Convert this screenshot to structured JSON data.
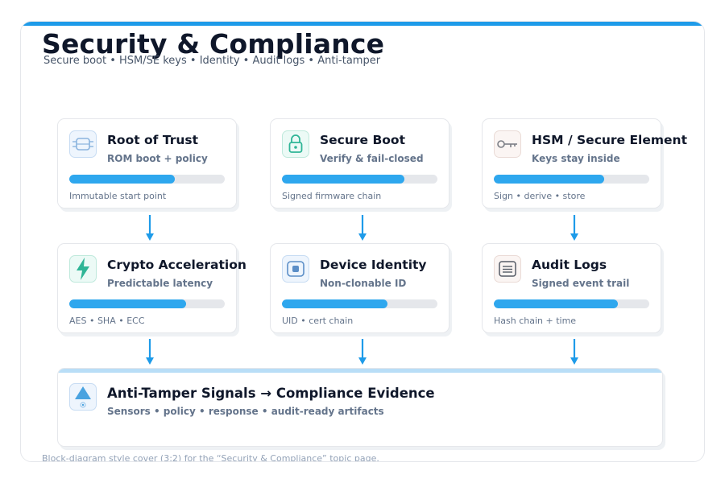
{
  "header": {
    "title": "Security & Compliance",
    "subtitle": "Secure boot • HSM/SE keys • Identity • Audit logs • Anti-tamper"
  },
  "cards": [
    {
      "title": "Root of Trust",
      "subtitle": "ROM boot + policy",
      "footer": "Immutable start point",
      "icon": "chip-icon",
      "progress": 0.68
    },
    {
      "title": "Secure Boot",
      "subtitle": "Verify & fail-closed",
      "footer": "Signed firmware chain",
      "icon": "lock-icon",
      "progress": 0.79
    },
    {
      "title": "HSM / Secure Element",
      "subtitle": "Keys stay inside",
      "footer": "Sign • derive • store",
      "icon": "key-icon",
      "progress": 0.71
    },
    {
      "title": "Crypto Acceleration",
      "subtitle": "Predictable latency",
      "footer": "AES • SHA • ECC",
      "icon": "lightning-icon",
      "progress": 0.75
    },
    {
      "title": "Device Identity",
      "subtitle": "Non-clonable ID",
      "footer": "UID • cert chain",
      "icon": "id-chip-icon",
      "progress": 0.68
    },
    {
      "title": "Audit Logs",
      "subtitle": "Signed event trail",
      "footer": "Hash chain + time",
      "icon": "document-lines-icon",
      "progress": 0.8
    }
  ],
  "bottom": {
    "title": "Anti-Tamper Signals → Compliance Evidence",
    "subtitle": "Sensors • policy • response • audit-ready artifacts",
    "icon": "alert-triangle-icon"
  },
  "footer_note": "Block-diagram style cover (3:2) for the “Security & Compliance” topic page.",
  "colors": {
    "accent": "#1e9be9",
    "bar_fill": "#2ea7ee",
    "bar_track": "#e5e7eb",
    "arrow": "#1e9be9",
    "title": "#0f172a",
    "muted": "#64748b"
  }
}
